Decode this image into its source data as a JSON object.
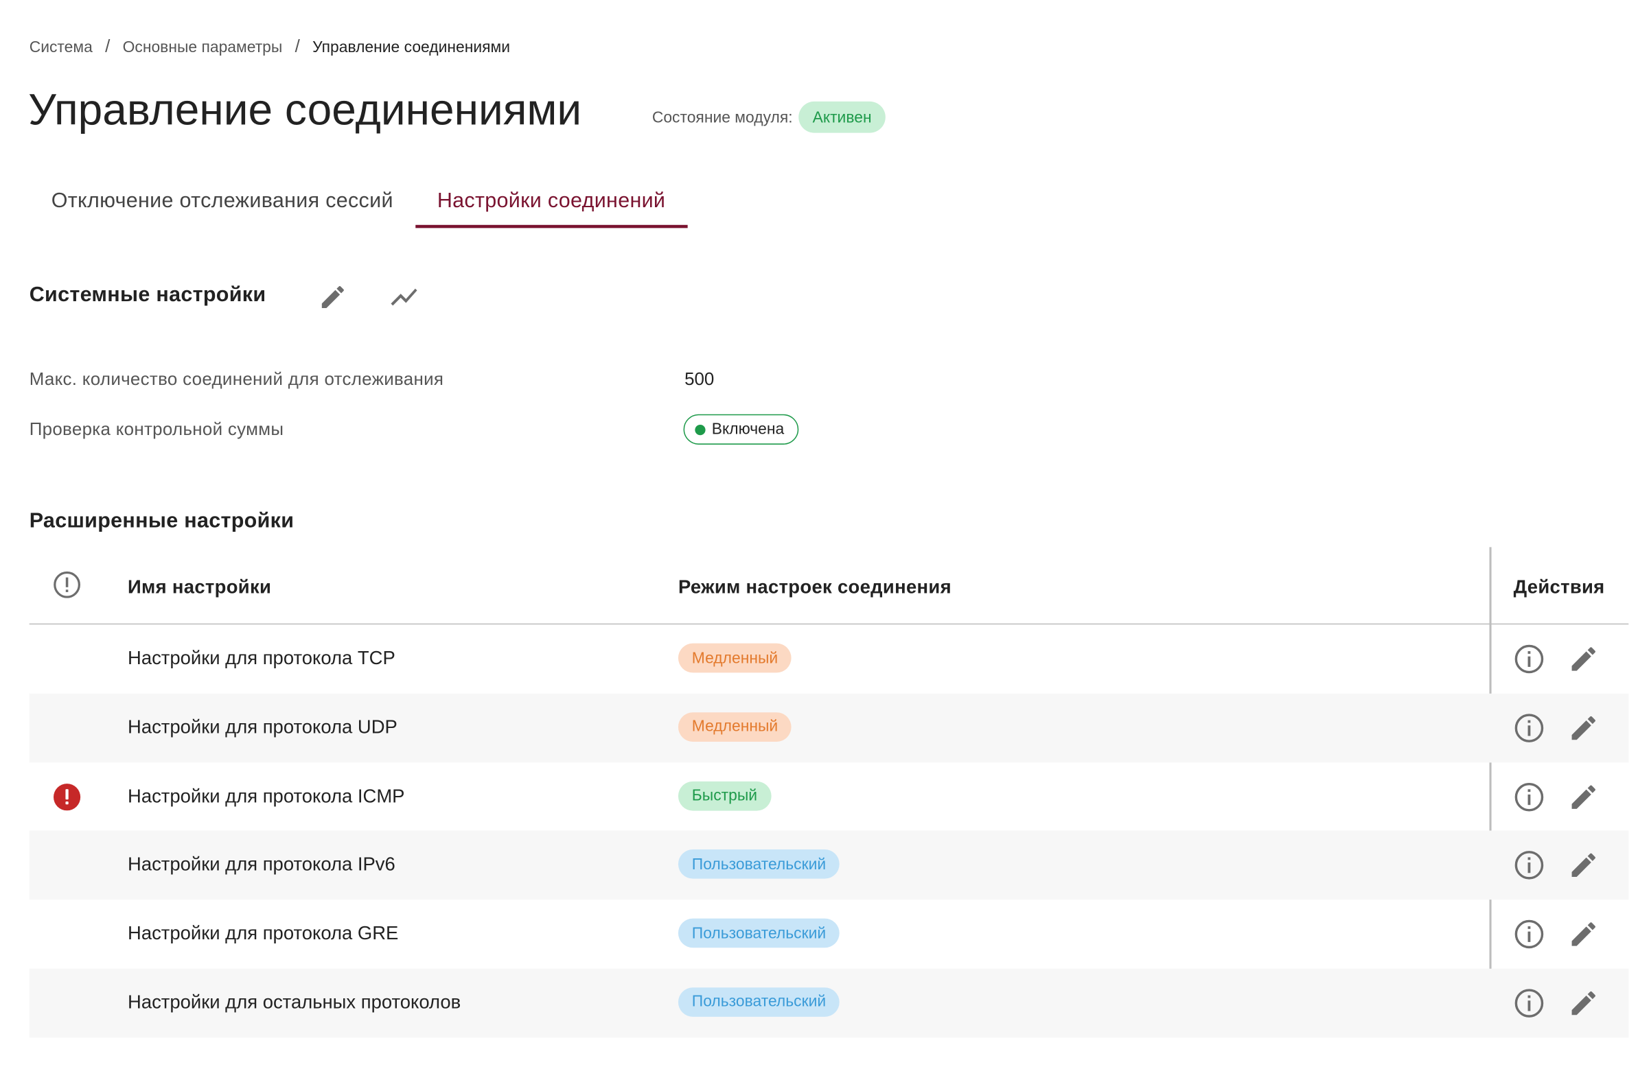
{
  "breadcrumb": {
    "items": [
      "Система",
      "Основные параметры"
    ],
    "current": "Управление соединениями",
    "separator": "/"
  },
  "page_title": "Управление соединениями",
  "module_state": {
    "label": "Состояние модуля:",
    "value": "Активен"
  },
  "tabs": [
    {
      "label": "Отключение отслеживания сессий",
      "active": false
    },
    {
      "label": "Настройки соединений",
      "active": true
    }
  ],
  "system_settings": {
    "title": "Системные настройки",
    "icons": [
      "pencil-icon",
      "trend-chart-icon"
    ],
    "max_connections": {
      "label": "Макс. количество соединений для отслеживания",
      "value": "500"
    },
    "checksum": {
      "label": "Проверка контрольной суммы",
      "value": "Включена"
    }
  },
  "extended_settings": {
    "title": "Расширенные настройки",
    "columns": {
      "warning_icon": "alert-circle-icon",
      "name": "Имя настройки",
      "mode": "Режим настроек соединения",
      "actions": "Действия"
    },
    "rows": [
      {
        "name": "Настройки для протокола TCP",
        "mode": "Медленный",
        "mode_type": "slow",
        "warning": false
      },
      {
        "name": "Настройки для протокола UDP",
        "mode": "Медленный",
        "mode_type": "slow",
        "warning": false
      },
      {
        "name": "Настройки для протокола ICMP",
        "mode": "Быстрый",
        "mode_type": "fast",
        "warning": true
      },
      {
        "name": "Настройки для протокола IPv6",
        "mode": "Пользовательский",
        "mode_type": "custom",
        "warning": false
      },
      {
        "name": "Настройки для протокола GRE",
        "mode": "Пользовательский",
        "mode_type": "custom",
        "warning": false
      },
      {
        "name": "Настройки для остальных протоколов",
        "mode": "Пользовательский",
        "mode_type": "custom",
        "warning": false
      }
    ],
    "row_actions": [
      "info-icon",
      "pencil-icon"
    ]
  },
  "colors": {
    "accent": "#7a1330",
    "success": "#1e9a4a",
    "success_bg": "#c8efd5",
    "slow_bg": "#fcd9c3",
    "slow_text": "#e37a2d",
    "custom_bg": "#c8e5f8",
    "custom_text": "#3a9bd8",
    "error": "#c62828",
    "icon_gray": "#6d6d6d"
  }
}
